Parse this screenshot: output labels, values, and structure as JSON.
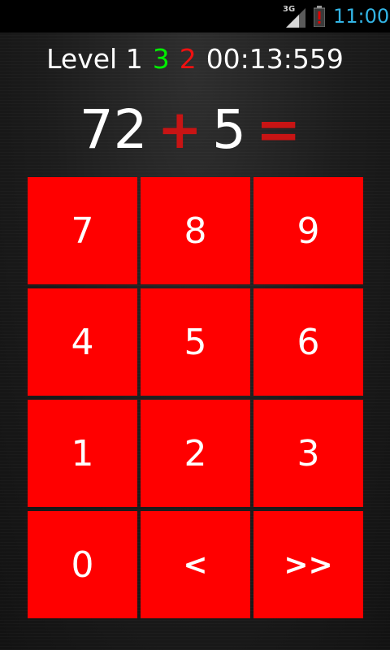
{
  "status_bar": {
    "network": "3G",
    "time": "11:00",
    "icons": [
      "signal-icon",
      "battery-alert-icon"
    ],
    "time_color": "#33b5e5"
  },
  "info": {
    "level_label": "Level 1",
    "correct_count": "3",
    "wrong_count": "2",
    "timer": "00:13:559",
    "correct_color": "#00ee00",
    "wrong_color": "#ee1111"
  },
  "equation": {
    "left": "72",
    "operator": "+",
    "right": "5",
    "equals": "="
  },
  "keypad": {
    "accent_color": "#ff0000",
    "keys": [
      "7",
      "8",
      "9",
      "4",
      "5",
      "6",
      "1",
      "2",
      "3",
      "0",
      "<",
      ">>"
    ]
  }
}
